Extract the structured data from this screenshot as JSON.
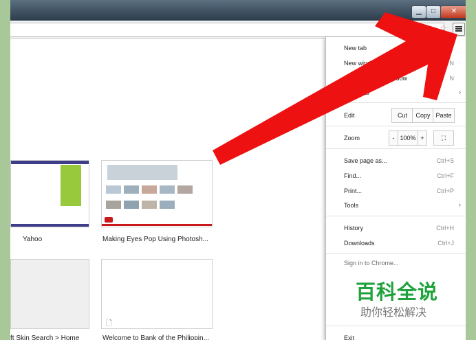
{
  "window": {
    "min_glyph": "▁",
    "max_glyph": "□",
    "close_glyph": "✕"
  },
  "toolbar": {
    "star_glyph": "☆"
  },
  "new_tab_page": {
    "tiles": [
      {
        "caption": "Yahoo"
      },
      {
        "caption": "Making Eyes Pop Using Photosh..."
      },
      {
        "caption": "ft Skin Search > Home"
      },
      {
        "caption": "Welcome to Bank of the Philippin..."
      }
    ]
  },
  "menu": {
    "new_tab": "New tab",
    "new_window": "New window",
    "new_window_sc": "N",
    "incognito_a": "Ne",
    "incognito_b": "window",
    "incognito_sc_a": "Ct",
    "incognito_sc_b": "N",
    "bookmarks": "marks",
    "edit": {
      "label": "Edit",
      "cut": "Cut",
      "copy": "Copy",
      "paste": "Paste"
    },
    "zoom": {
      "label": "Zoom",
      "minus": "-",
      "value": "100%",
      "plus": "+",
      "fullscreen": "⛶"
    },
    "save_page": {
      "label": "Save page as...",
      "shortcut": "Ctrl+S"
    },
    "find": {
      "label": "Find...",
      "shortcut": "Ctrl+F"
    },
    "print": {
      "label": "Print...",
      "shortcut": "Ctrl+P"
    },
    "tools": "Tools",
    "history": {
      "label": "History",
      "shortcut": "Ctrl+H"
    },
    "downloads": {
      "label": "Downloads",
      "shortcut": "Ctrl+J"
    },
    "sign_in": "Sign in to Chrome...",
    "exit": "Exit",
    "submenu_arrow": "›"
  },
  "annotation": {
    "color": "#ee1111"
  },
  "watermark": {
    "title": "百科全说",
    "subtitle": "助你轻松解决"
  }
}
